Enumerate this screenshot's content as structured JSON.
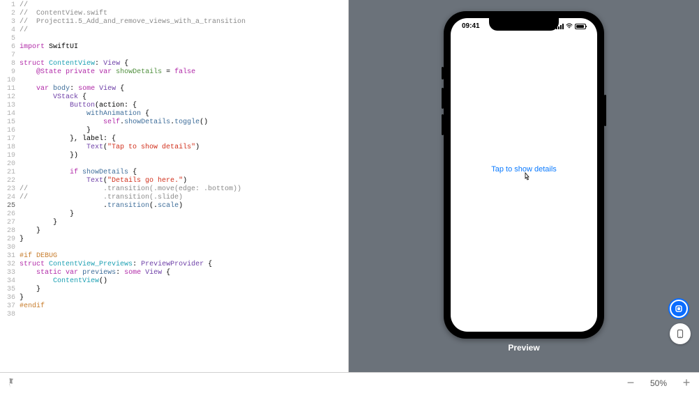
{
  "editor": {
    "current_line": 25,
    "lines": [
      {
        "n": 1,
        "tokens": [
          {
            "t": "//",
            "c": "c-comment"
          }
        ]
      },
      {
        "n": 2,
        "tokens": [
          {
            "t": "//  ContentView.swift",
            "c": "c-comment"
          }
        ]
      },
      {
        "n": 3,
        "tokens": [
          {
            "t": "//  Project11.5_Add_and_remove_views_with_a_transition",
            "c": "c-comment"
          }
        ]
      },
      {
        "n": 4,
        "tokens": [
          {
            "t": "//",
            "c": "c-comment"
          }
        ]
      },
      {
        "n": 5,
        "tokens": []
      },
      {
        "n": 6,
        "tokens": [
          {
            "t": "import",
            "c": "c-kw"
          },
          {
            "t": " "
          },
          {
            "t": "SwiftUI",
            "c": ""
          }
        ]
      },
      {
        "n": 7,
        "tokens": []
      },
      {
        "n": 8,
        "tokens": [
          {
            "t": "struct",
            "c": "c-kw"
          },
          {
            "t": " "
          },
          {
            "t": "ContentView",
            "c": "c-typedef"
          },
          {
            "t": ": "
          },
          {
            "t": "View",
            "c": "c-type"
          },
          {
            "t": " {"
          }
        ]
      },
      {
        "n": 9,
        "tokens": [
          {
            "t": "    "
          },
          {
            "t": "@State",
            "c": "c-kw"
          },
          {
            "t": " "
          },
          {
            "t": "private",
            "c": "c-kw"
          },
          {
            "t": " "
          },
          {
            "t": "var",
            "c": "c-kw"
          },
          {
            "t": " "
          },
          {
            "t": "showDetails",
            "c": "c-attr"
          },
          {
            "t": " = "
          },
          {
            "t": "false",
            "c": "c-kw"
          }
        ]
      },
      {
        "n": 10,
        "tokens": []
      },
      {
        "n": 11,
        "tokens": [
          {
            "t": "    "
          },
          {
            "t": "var",
            "c": "c-kw"
          },
          {
            "t": " "
          },
          {
            "t": "body",
            "c": "c-prop"
          },
          {
            "t": ": "
          },
          {
            "t": "some",
            "c": "c-kw"
          },
          {
            "t": " "
          },
          {
            "t": "View",
            "c": "c-type"
          },
          {
            "t": " {"
          }
        ]
      },
      {
        "n": 12,
        "tokens": [
          {
            "t": "        "
          },
          {
            "t": "VStack",
            "c": "c-type"
          },
          {
            "t": " {"
          }
        ]
      },
      {
        "n": 13,
        "tokens": [
          {
            "t": "            "
          },
          {
            "t": "Button",
            "c": "c-type"
          },
          {
            "t": "(action: {"
          }
        ]
      },
      {
        "n": 14,
        "tokens": [
          {
            "t": "                "
          },
          {
            "t": "withAnimation",
            "c": "c-call"
          },
          {
            "t": " {"
          }
        ]
      },
      {
        "n": 15,
        "tokens": [
          {
            "t": "                    "
          },
          {
            "t": "self",
            "c": "c-kw"
          },
          {
            "t": "."
          },
          {
            "t": "showDetails",
            "c": "c-prop"
          },
          {
            "t": "."
          },
          {
            "t": "toggle",
            "c": "c-call"
          },
          {
            "t": "()"
          }
        ]
      },
      {
        "n": 16,
        "tokens": [
          {
            "t": "                }"
          }
        ]
      },
      {
        "n": 17,
        "tokens": [
          {
            "t": "            }, label: {"
          }
        ]
      },
      {
        "n": 18,
        "tokens": [
          {
            "t": "                "
          },
          {
            "t": "Text",
            "c": "c-type"
          },
          {
            "t": "("
          },
          {
            "t": "\"Tap to show details\"",
            "c": "c-str"
          },
          {
            "t": ")"
          }
        ]
      },
      {
        "n": 19,
        "tokens": [
          {
            "t": "            })"
          }
        ]
      },
      {
        "n": 20,
        "tokens": []
      },
      {
        "n": 21,
        "tokens": [
          {
            "t": "            "
          },
          {
            "t": "if",
            "c": "c-kw"
          },
          {
            "t": " "
          },
          {
            "t": "showDetails",
            "c": "c-prop"
          },
          {
            "t": " {"
          }
        ]
      },
      {
        "n": 22,
        "tokens": [
          {
            "t": "                "
          },
          {
            "t": "Text",
            "c": "c-type"
          },
          {
            "t": "("
          },
          {
            "t": "\"Details go here.\"",
            "c": "c-str"
          },
          {
            "t": ")"
          }
        ]
      },
      {
        "n": 23,
        "tokens": [
          {
            "t": "//                  .transition(.move(edge: .bottom))",
            "c": "c-comment"
          }
        ]
      },
      {
        "n": 24,
        "tokens": [
          {
            "t": "//                  .transition(.slide)",
            "c": "c-comment"
          }
        ]
      },
      {
        "n": 25,
        "tokens": [
          {
            "t": "                    ."
          },
          {
            "t": "transition",
            "c": "c-call"
          },
          {
            "t": "(."
          },
          {
            "t": "scale",
            "c": "c-prop"
          },
          {
            "t": ")"
          }
        ]
      },
      {
        "n": 26,
        "tokens": [
          {
            "t": "            }"
          }
        ]
      },
      {
        "n": 27,
        "tokens": [
          {
            "t": "        }"
          }
        ]
      },
      {
        "n": 28,
        "tokens": [
          {
            "t": "    }"
          }
        ]
      },
      {
        "n": 29,
        "tokens": [
          {
            "t": "}"
          }
        ]
      },
      {
        "n": 30,
        "tokens": []
      },
      {
        "n": 31,
        "tokens": [
          {
            "t": "#if",
            "c": "c-pp"
          },
          {
            "t": " DEBUG",
            "c": "c-pp"
          }
        ]
      },
      {
        "n": 32,
        "tokens": [
          {
            "t": "struct",
            "c": "c-kw"
          },
          {
            "t": " "
          },
          {
            "t": "ContentView_Previews",
            "c": "c-typedef"
          },
          {
            "t": ": "
          },
          {
            "t": "PreviewProvider",
            "c": "c-type"
          },
          {
            "t": " {"
          }
        ]
      },
      {
        "n": 33,
        "tokens": [
          {
            "t": "    "
          },
          {
            "t": "static",
            "c": "c-kw"
          },
          {
            "t": " "
          },
          {
            "t": "var",
            "c": "c-kw"
          },
          {
            "t": " "
          },
          {
            "t": "previews",
            "c": "c-prop"
          },
          {
            "t": ": "
          },
          {
            "t": "some",
            "c": "c-kw"
          },
          {
            "t": " "
          },
          {
            "t": "View",
            "c": "c-type"
          },
          {
            "t": " {"
          }
        ]
      },
      {
        "n": 34,
        "tokens": [
          {
            "t": "        "
          },
          {
            "t": "ContentView",
            "c": "c-typedef"
          },
          {
            "t": "()"
          }
        ]
      },
      {
        "n": 35,
        "tokens": [
          {
            "t": "    }"
          }
        ]
      },
      {
        "n": 36,
        "tokens": [
          {
            "t": "}"
          }
        ]
      },
      {
        "n": 37,
        "tokens": [
          {
            "t": "#endif",
            "c": "c-pp"
          }
        ]
      },
      {
        "n": 38,
        "tokens": []
      }
    ]
  },
  "preview": {
    "status_time": "09:41",
    "button_text": "Tap to show details",
    "label": "Preview"
  },
  "bottom": {
    "zoom_minus": "−",
    "zoom_value": "50%",
    "zoom_plus": "+"
  },
  "icons": {
    "live_preview": "◎",
    "device_preview": "▢",
    "pin": "📌"
  }
}
